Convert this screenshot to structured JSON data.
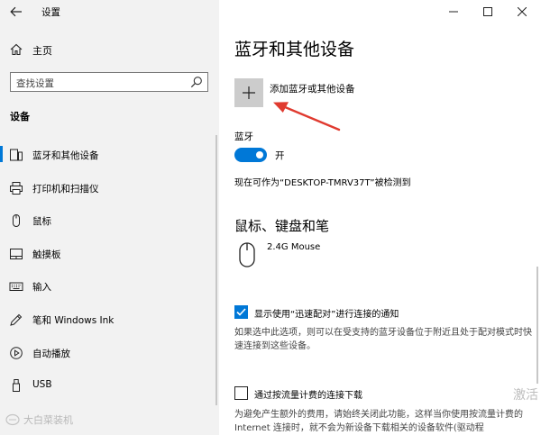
{
  "window": {
    "title": "设置"
  },
  "sidebar": {
    "home_label": "主页",
    "search_placeholder": "查找设置",
    "section_heading": "设备",
    "items": [
      {
        "label": "蓝牙和其他设备",
        "icon": "bluetooth-devices-icon",
        "active": true
      },
      {
        "label": "打印机和扫描仪",
        "icon": "printer-icon",
        "active": false
      },
      {
        "label": "鼠标",
        "icon": "mouse-icon",
        "active": false
      },
      {
        "label": "触摸板",
        "icon": "touchpad-icon",
        "active": false
      },
      {
        "label": "输入",
        "icon": "keyboard-icon",
        "active": false
      },
      {
        "label": "笔和 Windows Ink",
        "icon": "pen-icon",
        "active": false
      },
      {
        "label": "自动播放",
        "icon": "autoplay-icon",
        "active": false
      },
      {
        "label": "USB",
        "icon": "usb-icon",
        "active": false
      }
    ],
    "watermark": "大白菜装机"
  },
  "main": {
    "page_title": "蓝牙和其他设备",
    "add_device_label": "添加蓝牙或其他设备",
    "bluetooth_label": "蓝牙",
    "toggle_state": "开",
    "discoverable_text": "现在可作为“DESKTOP-TMRV37T”被检测到",
    "section_mouse_heading": "鼠标、键盘和笔",
    "device_name": "2.4G Mouse",
    "swift_pair_label": "显示使用“迅速配对”进行连接的通知",
    "swift_pair_desc": "如果选中此选项，则可以在受支持的蓝牙设备位于附近且处于配对模式时快速连接到这些设备。",
    "metered_label": "通过按流量计费的连接下载",
    "metered_desc": "为避免产生额外的费用，请始终关闭此功能，这样当你使用按流量计费的 Internet 连接时，就不会为新设备下载相关的设备软件(驱动程",
    "activate_watermark": "激活"
  },
  "colors": {
    "accent": "#0078d7",
    "arrow": "#e03a2f",
    "sidebar_bg": "#f2f2f2"
  }
}
